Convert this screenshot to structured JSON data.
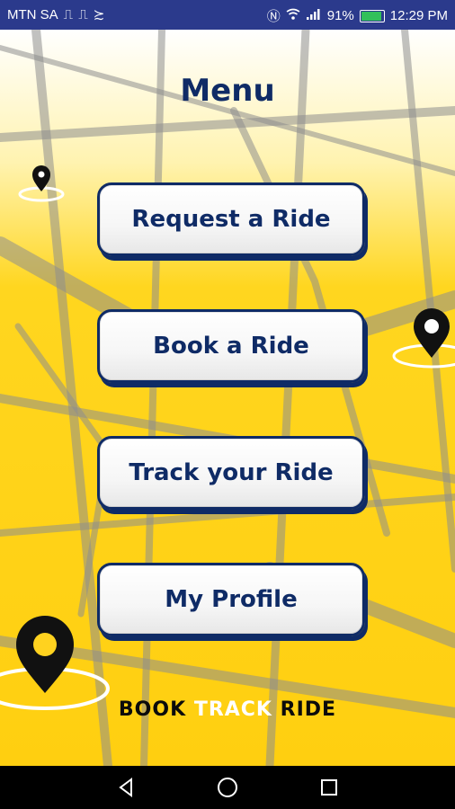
{
  "status": {
    "carrier": "MTN SA",
    "battery": "91%",
    "time": "12:29 PM"
  },
  "menu": {
    "title": "Menu",
    "buttons": [
      "Request a Ride",
      "Book a Ride",
      "Track your Ride",
      "My Profile"
    ]
  },
  "brand": {
    "book": "BOOK",
    "track": "TRACK",
    "ride": "RIDE"
  },
  "colors": {
    "status_bg": "#2b3a8c",
    "title": "#0f2b66",
    "yellow": "#ffd21f",
    "nav_bg": "#000000"
  }
}
